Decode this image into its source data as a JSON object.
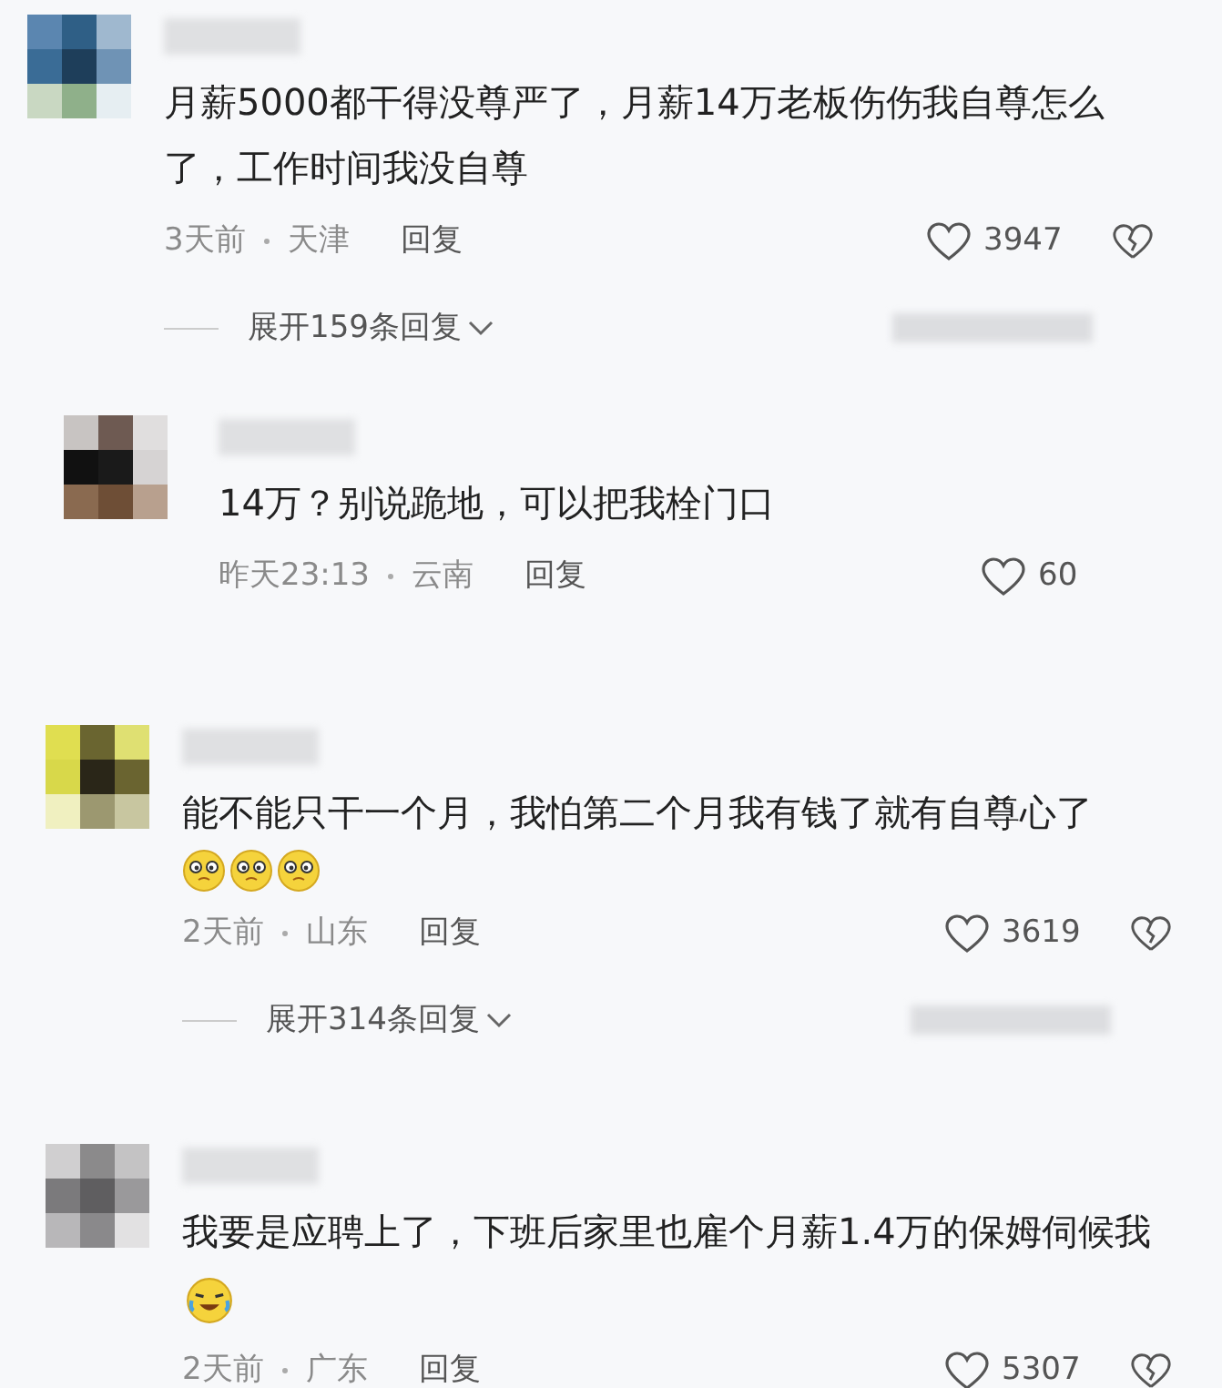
{
  "comments": [
    {
      "text": "月薪5000都干得没尊严了，月薪14万老板伤伤我自尊怎么了，工作时间我没自尊",
      "time": "3天前",
      "location": "天津",
      "reply": "回复",
      "likes": "3947",
      "dislike": true,
      "expand": "展开159条回复"
    },
    {
      "text": "14万？别说跪地，可以把我栓门口",
      "time": "昨天23:13",
      "location": "云南",
      "reply": "回复",
      "likes": "60",
      "dislike": false
    },
    {
      "text": "能不能只干一个月，我怕第二个月我有钱了就有自尊心了",
      "stickers": [
        {
          "kind": "squint"
        },
        {
          "kind": "squint"
        },
        {
          "kind": "squint"
        }
      ],
      "time": "2天前",
      "location": "山东",
      "reply": "回复",
      "likes": "3619",
      "dislike": true,
      "expand": "展开314条回复"
    },
    {
      "text": "我要是应聘上了，下班后家里也雇个月薪1.4万的保姆伺候我",
      "stickers": [
        {
          "kind": "crying"
        }
      ],
      "time": "2天前",
      "location": "广东",
      "reply": "回复",
      "likes": "5307",
      "dislike": true
    }
  ]
}
